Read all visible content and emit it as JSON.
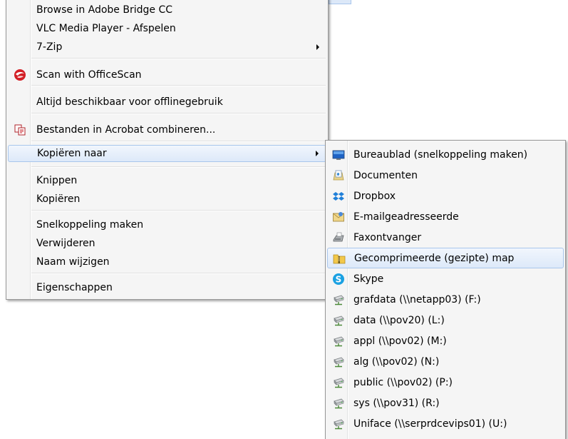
{
  "main_menu": {
    "items": [
      {
        "label": "Browse in Adobe Bridge CC"
      },
      {
        "label": "VLC Media Player - Afspelen"
      },
      {
        "label": "7-Zip"
      },
      {
        "label": "Scan with OfficeScan",
        "icon": "officescan-icon"
      },
      {
        "label": "Altijd beschikbaar voor offlinegebruik"
      },
      {
        "label": "Bestanden in Acrobat combineren...",
        "icon": "acrobat-combine-icon"
      },
      {
        "label": "Kopiëren naar"
      },
      {
        "label": "Knippen"
      },
      {
        "label": "Kopiëren"
      },
      {
        "label": "Snelkoppeling maken"
      },
      {
        "label": "Verwijderen"
      },
      {
        "label": "Naam wijzigen"
      },
      {
        "label": "Eigenschappen"
      }
    ]
  },
  "submenu": {
    "items": [
      {
        "label": "Bureaublad (snelkoppeling maken)",
        "icon": "desktop-icon"
      },
      {
        "label": "Documenten",
        "icon": "documents-icon"
      },
      {
        "label": "Dropbox",
        "icon": "dropbox-icon"
      },
      {
        "label": "E-mailgeadresseerde",
        "icon": "mail-recipient-icon"
      },
      {
        "label": "Faxontvanger",
        "icon": "fax-icon"
      },
      {
        "label": "Gecomprimeerde (gezipte) map",
        "icon": "zip-folder-icon"
      },
      {
        "label": "Skype",
        "icon": "skype-icon"
      },
      {
        "label": "grafdata (\\\\netapp03) (F:)",
        "icon": "network-drive-icon"
      },
      {
        "label": "data (\\\\pov20) (L:)",
        "icon": "network-drive-icon"
      },
      {
        "label": "appl (\\\\pov02) (M:)",
        "icon": "network-drive-icon"
      },
      {
        "label": "alg (\\\\pov02) (N:)",
        "icon": "network-drive-icon"
      },
      {
        "label": "public (\\\\pov02) (P:)",
        "icon": "network-drive-icon"
      },
      {
        "label": "sys (\\\\pov31) (R:)",
        "icon": "network-drive-icon"
      },
      {
        "label": "Uniface (\\\\serprdcevips01) (U:)",
        "icon": "network-drive-icon"
      }
    ]
  },
  "colors": {
    "highlight_border": "#a9c6ec",
    "menu_background": "#f5f5f5",
    "menu_border": "#979797"
  }
}
